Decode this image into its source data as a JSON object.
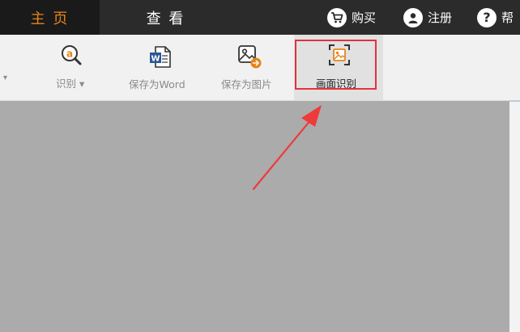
{
  "tabs": [
    {
      "label": "主 页"
    },
    {
      "label": "查 看"
    }
  ],
  "top_actions": {
    "buy": {
      "label": "购买",
      "icon": "cart-icon"
    },
    "register": {
      "label": "注册",
      "icon": "user-icon"
    },
    "help": {
      "label": "帮",
      "icon": "question-icon"
    }
  },
  "ribbon": {
    "first_dropdown": {
      "label": "▾"
    },
    "recognize": {
      "label": "识别 ▾",
      "icon": "magnifier-a-icon"
    },
    "save_word": {
      "label": "保存为Word",
      "icon": "word-doc-icon"
    },
    "save_image": {
      "label": "保存为图片",
      "icon": "image-export-icon"
    },
    "screen_recognize": {
      "label": "画面识别",
      "icon": "image-scan-icon"
    }
  },
  "colors": {
    "accent": "#e8841a",
    "highlight": "#e2333b",
    "canvas": "#ababab",
    "topbar": "#2b2b2b"
  }
}
